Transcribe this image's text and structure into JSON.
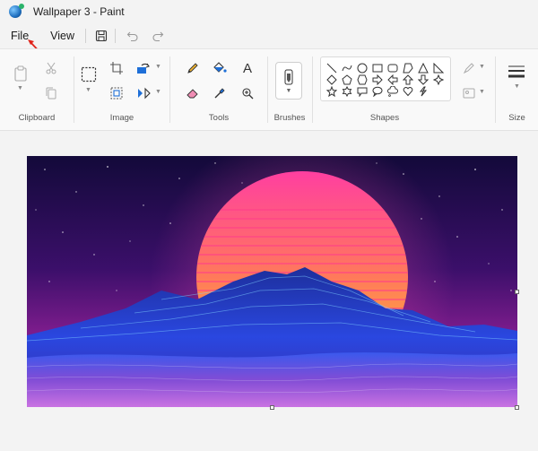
{
  "window": {
    "title": "Wallpaper  3 - Paint"
  },
  "menu": {
    "file_label": "File",
    "view_label": "View"
  },
  "quick_access": [
    "save-icon",
    "undo-icon",
    "redo-icon"
  ],
  "ribbon": {
    "groups": {
      "clipboard": "Clipboard",
      "image": "Image",
      "tools": "Tools",
      "brushes": "Brushes",
      "shapes": "Shapes",
      "size": "Size"
    },
    "text_tool_glyph": "A"
  },
  "colors": {
    "annotation_arrow": "#e0241b",
    "canvas_bg": "#f3f3f3",
    "sun_top": "#ff3fa0",
    "sun_bottom": "#ffb02e",
    "sky_top": "#140a3c",
    "mountain": "#2a3bd6"
  },
  "canvas": {
    "image_description_icon": "synthwave-wallpaper-image"
  }
}
